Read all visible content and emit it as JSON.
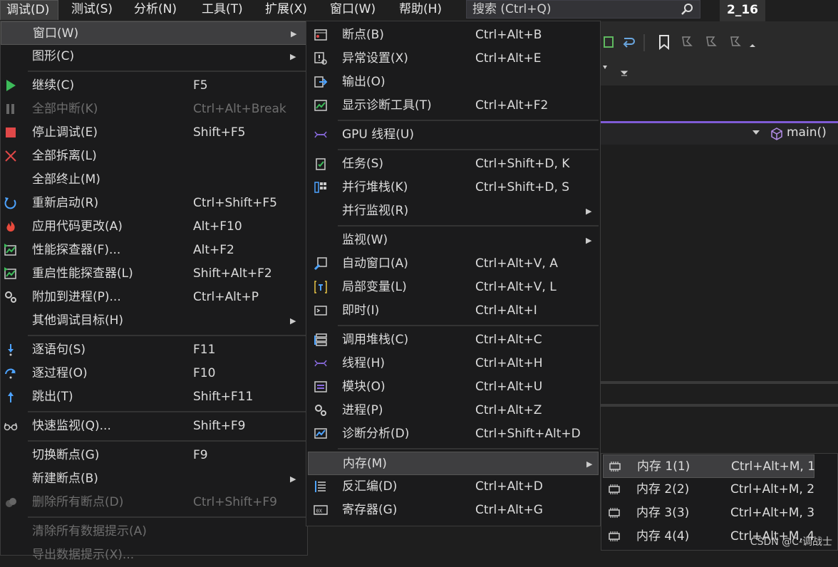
{
  "menubar": {
    "items": [
      "调试(D)",
      "测试(S)",
      "分析(N)",
      "工具(T)",
      "扩展(X)",
      "窗口(W)",
      "帮助(H)"
    ],
    "search_placeholder": "搜索 (Ctrl+Q)",
    "solution": "2_16"
  },
  "editor": {
    "nav_function": "main()"
  },
  "debug_menu": [
    {
      "label": "窗口(W)",
      "shortcut": "",
      "submenu": true,
      "icon": "none"
    },
    {
      "label": "图形(C)",
      "shortcut": "",
      "submenu": true,
      "icon": "none"
    },
    {
      "label": "继续(C)",
      "shortcut": "F5",
      "icon": "play-icon"
    },
    {
      "label": "全部中断(K)",
      "shortcut": "Ctrl+Alt+Break",
      "icon": "pause-icon",
      "disabled": true
    },
    {
      "label": "停止调试(E)",
      "shortcut": "Shift+F5",
      "icon": "stop-icon"
    },
    {
      "label": "全部拆离(L)",
      "shortcut": "",
      "icon": "detach-x-icon"
    },
    {
      "label": "全部终止(M)",
      "shortcut": "",
      "icon": "none"
    },
    {
      "label": "重新启动(R)",
      "shortcut": "Ctrl+Shift+F5",
      "icon": "restart-icon"
    },
    {
      "label": "应用代码更改(A)",
      "shortcut": "Alt+F10",
      "icon": "hot-reload-icon"
    },
    {
      "label": "性能探查器(F)...",
      "shortcut": "Alt+F2",
      "icon": "profiler-icon"
    },
    {
      "label": "重启性能探查器(L)",
      "shortcut": "Shift+Alt+F2",
      "icon": "profiler-icon"
    },
    {
      "label": "附加到进程(P)...",
      "shortcut": "Ctrl+Alt+P",
      "icon": "gears-icon"
    },
    {
      "label": "其他调试目标(H)",
      "shortcut": "",
      "submenu": true,
      "icon": "none"
    },
    {
      "label": "逐语句(S)",
      "shortcut": "F11",
      "icon": "step-into-icon"
    },
    {
      "label": "逐过程(O)",
      "shortcut": "F10",
      "icon": "step-over-icon"
    },
    {
      "label": "跳出(T)",
      "shortcut": "Shift+F11",
      "icon": "step-out-icon"
    },
    {
      "label": "快速监视(Q)...",
      "shortcut": "Shift+F9",
      "icon": "glasses-icon"
    },
    {
      "label": "切换断点(G)",
      "shortcut": "F9",
      "icon": "none"
    },
    {
      "label": "新建断点(B)",
      "shortcut": "",
      "submenu": true,
      "icon": "none"
    },
    {
      "label": "删除所有断点(D)",
      "shortcut": "Ctrl+Shift+F9",
      "icon": "delete-breakpoints-icon",
      "disabled": true
    },
    {
      "label": "清除所有数据提示(A)",
      "shortcut": "",
      "icon": "none",
      "disabled": true
    },
    {
      "label": "导出数据提示(X)...",
      "shortcut": "",
      "icon": "none",
      "disabled": true
    }
  ],
  "window_menu": [
    {
      "label": "断点(B)",
      "shortcut": "Ctrl+Alt+B",
      "icon": "breakpoints-window-icon"
    },
    {
      "label": "异常设置(X)",
      "shortcut": "Ctrl+Alt+E",
      "icon": "exception-settings-icon"
    },
    {
      "label": "输出(O)",
      "shortcut": "",
      "icon": "output-icon"
    },
    {
      "label": "显示诊断工具(T)",
      "shortcut": "Ctrl+Alt+F2",
      "icon": "diagnostic-tools-icon"
    },
    {
      "label": "GPU 线程(U)",
      "shortcut": "",
      "icon": "gpu-threads-icon"
    },
    {
      "label": "任务(S)",
      "shortcut": "Ctrl+Shift+D, K",
      "icon": "tasks-icon"
    },
    {
      "label": "并行堆栈(K)",
      "shortcut": "Ctrl+Shift+D, S",
      "icon": "parallel-stacks-icon"
    },
    {
      "label": "并行监视(R)",
      "shortcut": "",
      "submenu": true,
      "icon": "none"
    },
    {
      "label": "监视(W)",
      "shortcut": "",
      "submenu": true,
      "icon": "none"
    },
    {
      "label": "自动窗口(A)",
      "shortcut": "Ctrl+Alt+V, A",
      "icon": "autos-icon"
    },
    {
      "label": "局部变量(L)",
      "shortcut": "Ctrl+Alt+V, L",
      "icon": "locals-icon"
    },
    {
      "label": "即时(I)",
      "shortcut": "Ctrl+Alt+I",
      "icon": "immediate-icon"
    },
    {
      "label": "调用堆栈(C)",
      "shortcut": "Ctrl+Alt+C",
      "icon": "call-stack-icon"
    },
    {
      "label": "线程(H)",
      "shortcut": "Ctrl+Alt+H",
      "icon": "threads-icon"
    },
    {
      "label": "模块(O)",
      "shortcut": "Ctrl+Alt+U",
      "icon": "modules-icon"
    },
    {
      "label": "进程(P)",
      "shortcut": "Ctrl+Alt+Z",
      "icon": "processes-icon"
    },
    {
      "label": "诊断分析(D)",
      "shortcut": "Ctrl+Shift+Alt+D",
      "icon": "diagnostic-analysis-icon"
    },
    {
      "label": "内存(M)",
      "shortcut": "",
      "submenu": true,
      "icon": "none",
      "highlight": true
    },
    {
      "label": "反汇编(D)",
      "shortcut": "Ctrl+Alt+D",
      "icon": "disassembly-icon"
    },
    {
      "label": "寄存器(G)",
      "shortcut": "Ctrl+Alt+G",
      "icon": "registers-icon"
    }
  ],
  "memory_menu": [
    {
      "label": "内存 1(1)",
      "shortcut": "Ctrl+Alt+M, 1",
      "highlight": true
    },
    {
      "label": "内存 2(2)",
      "shortcut": "Ctrl+Alt+M, 2"
    },
    {
      "label": "内存 3(3)",
      "shortcut": "Ctrl+Alt+M, 3"
    },
    {
      "label": "内存 4(4)",
      "shortcut": "Ctrl+Alt+M, 4"
    }
  ],
  "watermark": "CSDN @C-调战士"
}
